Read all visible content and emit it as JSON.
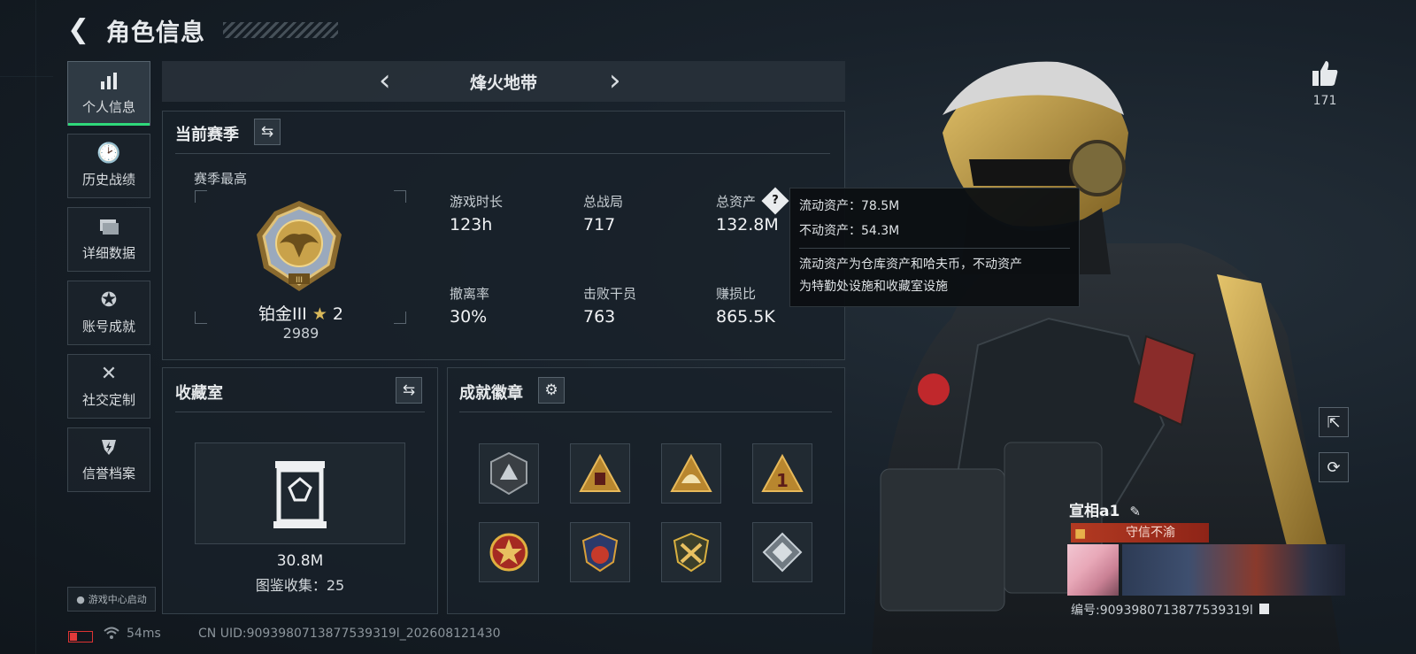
{
  "header": {
    "title": "角色信息"
  },
  "sidebar": {
    "items": [
      {
        "label": "个人信息",
        "icon": "bar-chart-icon"
      },
      {
        "label": "历史战绩",
        "icon": "clock-history-icon"
      },
      {
        "label": "详细数据",
        "icon": "folders-icon"
      },
      {
        "label": "账号成就",
        "icon": "medal-icon"
      },
      {
        "label": "社交定制",
        "icon": "tools-icon"
      },
      {
        "label": "信誉档案",
        "icon": "shield-lightning-icon"
      }
    ],
    "game_center_label": "游戏中心启动"
  },
  "mode": {
    "title": "烽火地带"
  },
  "season": {
    "heading": "当前赛季",
    "best_label": "赛季最高",
    "rank_name": "铂金III",
    "rank_stars": "2",
    "rank_score": "2989",
    "stats": [
      {
        "key": "游戏时长",
        "value": "123h"
      },
      {
        "key": "总战局",
        "value": "717"
      },
      {
        "key": "总资产",
        "value": "132.8M"
      },
      {
        "key": "撤离率",
        "value": "30%"
      },
      {
        "key": "击败干员",
        "value": "763"
      },
      {
        "key": "赚损比",
        "value": "865.5K"
      }
    ]
  },
  "tooltip": {
    "liquid": "流动资产：78.5M",
    "fixed": "不动资产：54.3M",
    "desc_line1": "流动资产为仓库资产和哈夫币，不动资产",
    "desc_line2": "为特勤处设施和收藏室设施"
  },
  "collection": {
    "heading": "收藏室",
    "value": "30.8M",
    "count": "图鉴收集：25"
  },
  "badges": {
    "heading": "成就徽章"
  },
  "status": {
    "ping": "54ms",
    "uid": "CN UID:9093980713877539319l_202608121430"
  },
  "likes": {
    "count": "171"
  },
  "player": {
    "name": "宣相a1",
    "honor": "守信不渝",
    "id": "编号:9093980713877539319l"
  },
  "colors": {
    "accent_green": "#2fd87a",
    "honor_red": "#b33a22",
    "gold": "#c9a24a"
  }
}
